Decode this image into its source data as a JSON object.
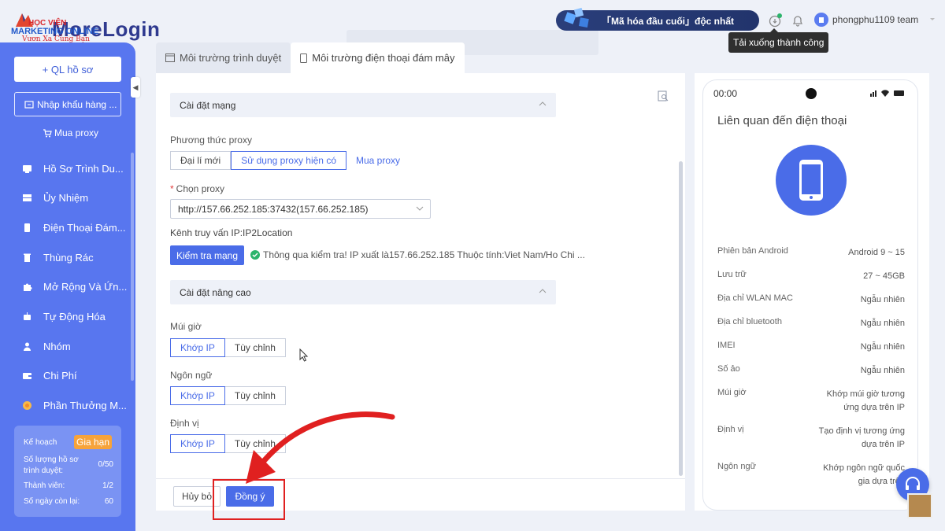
{
  "app": {
    "logo_text": "MoreLogin",
    "watermark_line1": "HỌC VIỆN",
    "watermark_line2": "MARKETING ONLINE",
    "watermark_line3": "Vươn Xa Cùng Bạn"
  },
  "topbar": {
    "promo": "「Mã hóa đầu cuối」độc nhất",
    "username": "phongphu1109 team",
    "tooltip": "Tải xuống thành công"
  },
  "sidebar": {
    "new_profile": "+ QL hồ sơ",
    "import": "Nhập khẩu hàng ...",
    "buy_proxy": "Mua proxy",
    "items": [
      {
        "label": "Hồ Sơ Trình Du...",
        "icon": "browser-icon"
      },
      {
        "label": "Ủy Nhiệm",
        "icon": "proxy-icon"
      },
      {
        "label": "Điện Thoại Đám...",
        "icon": "phone-icon"
      },
      {
        "label": "Thùng Rác",
        "icon": "trash-icon"
      },
      {
        "label": "Mở Rộng Và Ứn...",
        "icon": "puzzle-icon"
      },
      {
        "label": "Tự Động Hóa",
        "icon": "robot-icon"
      },
      {
        "label": "Nhóm",
        "icon": "group-icon"
      },
      {
        "label": "Chi Phí",
        "icon": "wallet-icon"
      },
      {
        "label": "Phần Thưởng M...",
        "icon": "reward-icon"
      }
    ],
    "plan": {
      "title": "Kế hoạch",
      "renew": "Gia hạn",
      "rows": [
        {
          "label": "Số lượng hồ sơ trình duyệt:",
          "value": "0/50"
        },
        {
          "label": "Thành viên:",
          "value": "1/2"
        },
        {
          "label": "Số ngày còn lại:",
          "value": "60"
        }
      ]
    }
  },
  "tabs": [
    {
      "label": "Môi trường trình duyệt"
    },
    {
      "label": "Môi trường điện thoại đám mây"
    }
  ],
  "form": {
    "network_section": "Cài đặt mạng",
    "proxy_method_label": "Phương thức proxy",
    "proxy_methods": [
      "Đại lí mới",
      "Sử dụng proxy hiện có",
      "Mua proxy"
    ],
    "choose_proxy_label": "Chọn proxy",
    "proxy_value": "http://157.66.252.185:37432(157.66.252.185)",
    "ip_channel": "Kênh truy vấn IP:IP2Location",
    "check_button": "Kiểm tra mạng",
    "check_result": "Thông qua kiểm tra! IP xuất là157.66.252.185 Thuộc tính:Viet Nam/Ho Chi ...",
    "advanced_section": "Cài đặt nâng cao",
    "timezone_label": "Múi giờ",
    "language_label": "Ngôn ngữ",
    "location_label": "Định vị",
    "match_ip": "Khớp IP",
    "custom": "Tùy chỉnh",
    "cancel": "Hủy bỏ",
    "ok": "Đồng ý"
  },
  "phone": {
    "time": "00:00",
    "title": "Liên quan đến điện thoại",
    "specs": [
      {
        "label": "Phiên bản Android",
        "value": "Android 9 ~ 15"
      },
      {
        "label": "Lưu trữ",
        "value": "27 ~ 45GB"
      },
      {
        "label": "Địa chỉ WLAN MAC",
        "value": "Ngẫu nhiên"
      },
      {
        "label": "Địa chỉ bluetooth",
        "value": "Ngẫu nhiên"
      },
      {
        "label": "IMEI",
        "value": "Ngẫu nhiên"
      },
      {
        "label": "Số ảo",
        "value": "Ngẫu nhiên"
      },
      {
        "label": "Múi giờ",
        "value": "Khớp múi giờ tương ứng dựa trên IP"
      },
      {
        "label": "Định vị",
        "value": "Tạo định vị tương ứng dựa trên IP"
      },
      {
        "label": "Ngôn ngữ",
        "value": "Khớp ngôn ngữ quốc gia dựa trên"
      }
    ]
  },
  "colors": {
    "accent": "#4a6ce8",
    "sidebar": "#5876ef",
    "annotation": "#e02020"
  }
}
